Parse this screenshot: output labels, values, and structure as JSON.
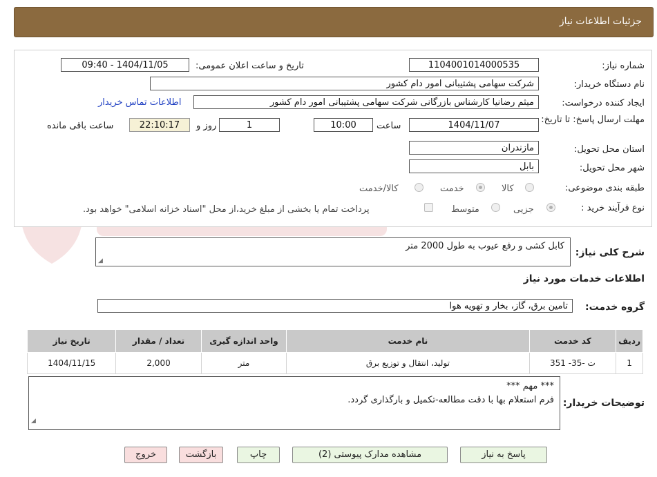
{
  "header": {
    "title": "جزئیات اطلاعات نیاز"
  },
  "form": {
    "need_number_label": "شماره نیاز:",
    "need_number": "1104001014000535",
    "announce_label": "تاریخ و ساعت اعلان عمومی:",
    "announce_value": "1404/11/05 - 09:40",
    "buyer_org_label": "نام دستگاه خریدار:",
    "buyer_org": "شرکت سهامی پشتیبانی امور دام کشور",
    "creator_label": "ایجاد کننده درخواست:",
    "creator": "میثم رضانیا کارشناس بازرگانی شرکت سهامی پشتیبانی امور دام کشور",
    "contact_link": "اطلاعات تماس خریدار",
    "deadline_label": "مهلت ارسال پاسخ: تا تاریخ:",
    "deadline_date": "1404/11/07",
    "time_label": "ساعت",
    "deadline_time": "10:00",
    "days_value": "1",
    "days_label": "روز و",
    "remaining_time": "22:10:17",
    "remaining_label": "ساعت باقی مانده",
    "province_label": "استان محل تحویل:",
    "province": "مازندران",
    "city_label": "شهر محل تحویل:",
    "city": "بابل",
    "category_label": "طبقه بندی موضوعی:",
    "category_options": [
      "کالا",
      "خدمت",
      "کالا/خدمت"
    ],
    "process_label": "نوع فرآیند خرید :",
    "process_options": [
      "جزیی",
      "متوسط"
    ],
    "payment_note": "پرداخت تمام یا بخشی از مبلغ خرید،از محل \"اسناد خزانه اسلامی\" خواهد بود."
  },
  "summary": {
    "label": "شرح کلی نیاز:",
    "text": "کابل کشی و رفع عیوب به طول 2000 متر"
  },
  "services": {
    "section_title": "اطلاعات خدمات مورد نیاز",
    "group_label": "گروه خدمت:",
    "group_value": "تامین برق، گاز، بخار و تهویه هوا",
    "columns": [
      "ردیف",
      "کد خدمت",
      "نام خدمت",
      "واحد اندازه گیری",
      "تعداد / مقدار",
      "تاریخ نیاز"
    ],
    "rows": [
      [
        "1",
        "ت -35- 351",
        "تولید، انتقال و توزیع برق",
        "متر",
        "2,000",
        "1404/11/15"
      ]
    ]
  },
  "buyer_notes": {
    "label": "توضیحات خریدار:",
    "line1": "*** مهم ***",
    "line2": "فرم استعلام بها با دقت مطالعه-تکمیل و بارگذاری گردد."
  },
  "buttons": {
    "reply": "پاسخ به نیاز",
    "attachments": "مشاهده مدارک پیوستی (2)",
    "print": "چاپ",
    "back": "بازگشت",
    "exit": "خروج"
  },
  "colors": {
    "header_bg": "#8b6a3f",
    "button_bg": "#eaf6e2",
    "button_red_bg": "#f9dede",
    "link": "#1f3fc2"
  }
}
